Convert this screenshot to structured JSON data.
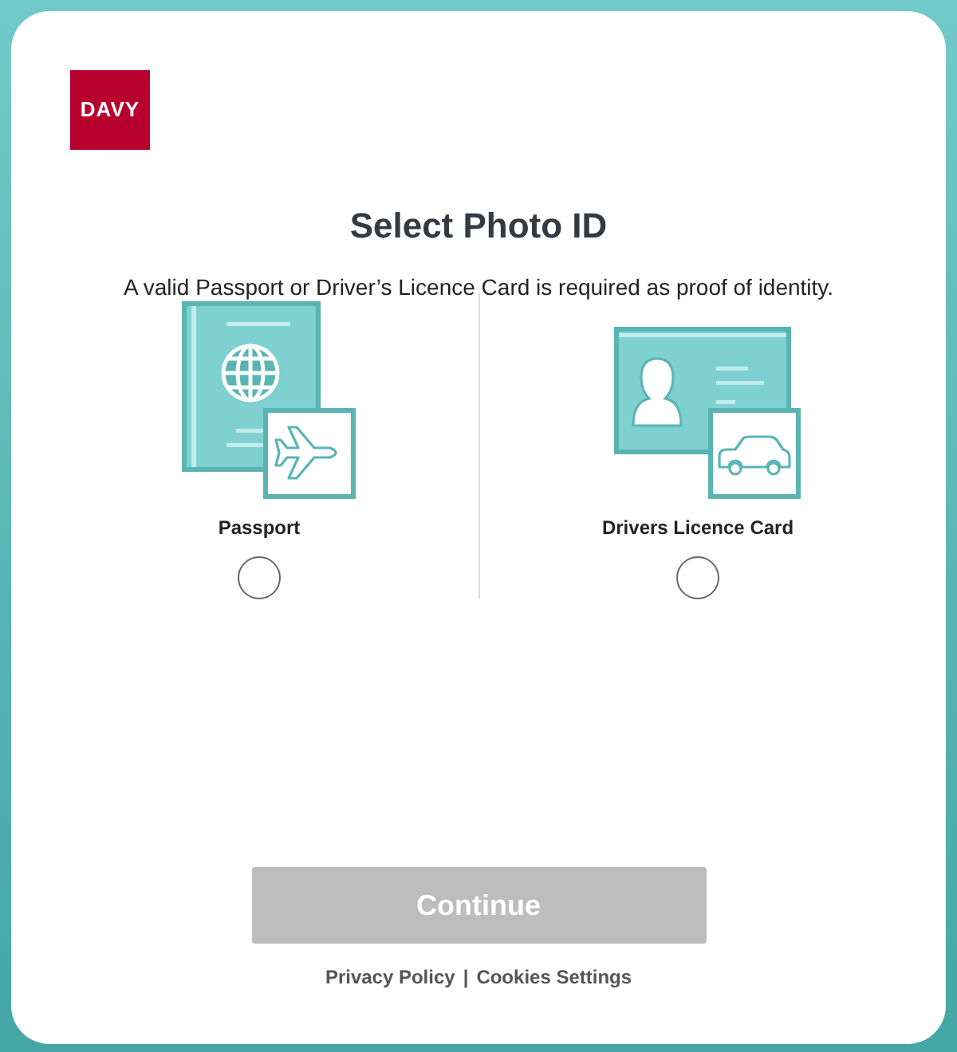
{
  "logo": {
    "text": "DAVY"
  },
  "title": "Select Photo ID",
  "subtitle": "A valid Passport or Driver’s Licence Card is required as proof of identity.",
  "options": [
    {
      "kind": "passport",
      "label": "Passport",
      "selected": false
    },
    {
      "kind": "licence",
      "label": "Drivers Licence Card",
      "selected": false
    }
  ],
  "continue_button": {
    "label": "Continue",
    "disabled": true
  },
  "footer_links": [
    {
      "label": "Privacy Policy"
    },
    {
      "label": "Cookies Settings"
    }
  ],
  "footer_separator": "|"
}
